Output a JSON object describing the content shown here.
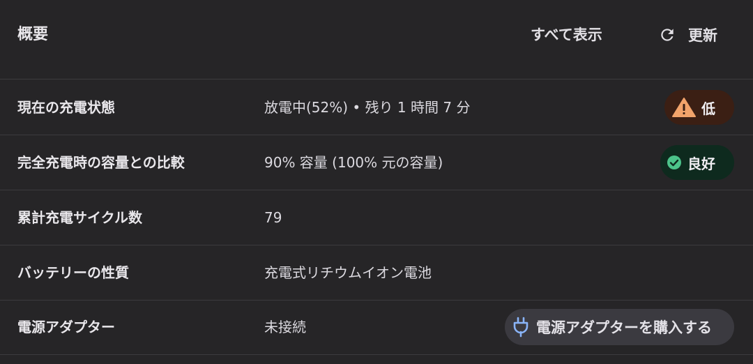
{
  "header": {
    "title": "概要",
    "show_all_label": "すべて表示",
    "refresh_label": "更新",
    "refresh_icon": "refresh-icon"
  },
  "rows": [
    {
      "label": "現在の充電状態",
      "value": "放電中(52%) • 残り 1 時間 7 分",
      "badge": {
        "label": "低",
        "icon": "warning-icon",
        "background": "#3b1f14",
        "icon_color": "#f2a36b"
      }
    },
    {
      "label": "完全充電時の容量との比較",
      "value": "90% 容量 (100% 元の容量)",
      "badge": {
        "label": "良好",
        "icon": "check-circle-icon",
        "background": "#0e2a1e",
        "icon_color": "#4cc38a"
      }
    },
    {
      "label": "累計充電サイクル数",
      "value": "79"
    },
    {
      "label": "バッテリーの性質",
      "value": "充電式リチウムイオン電池"
    },
    {
      "label": "電源アダプター",
      "value": "未接続",
      "action": {
        "label": "電源アダプターを購入する",
        "icon": "plug-icon",
        "icon_color": "#8ab4f8"
      }
    }
  ],
  "colors": {
    "background": "#262527",
    "divider": "#3c3b3e",
    "text": "#e8e6ea",
    "button_background": "#3b3a40"
  }
}
